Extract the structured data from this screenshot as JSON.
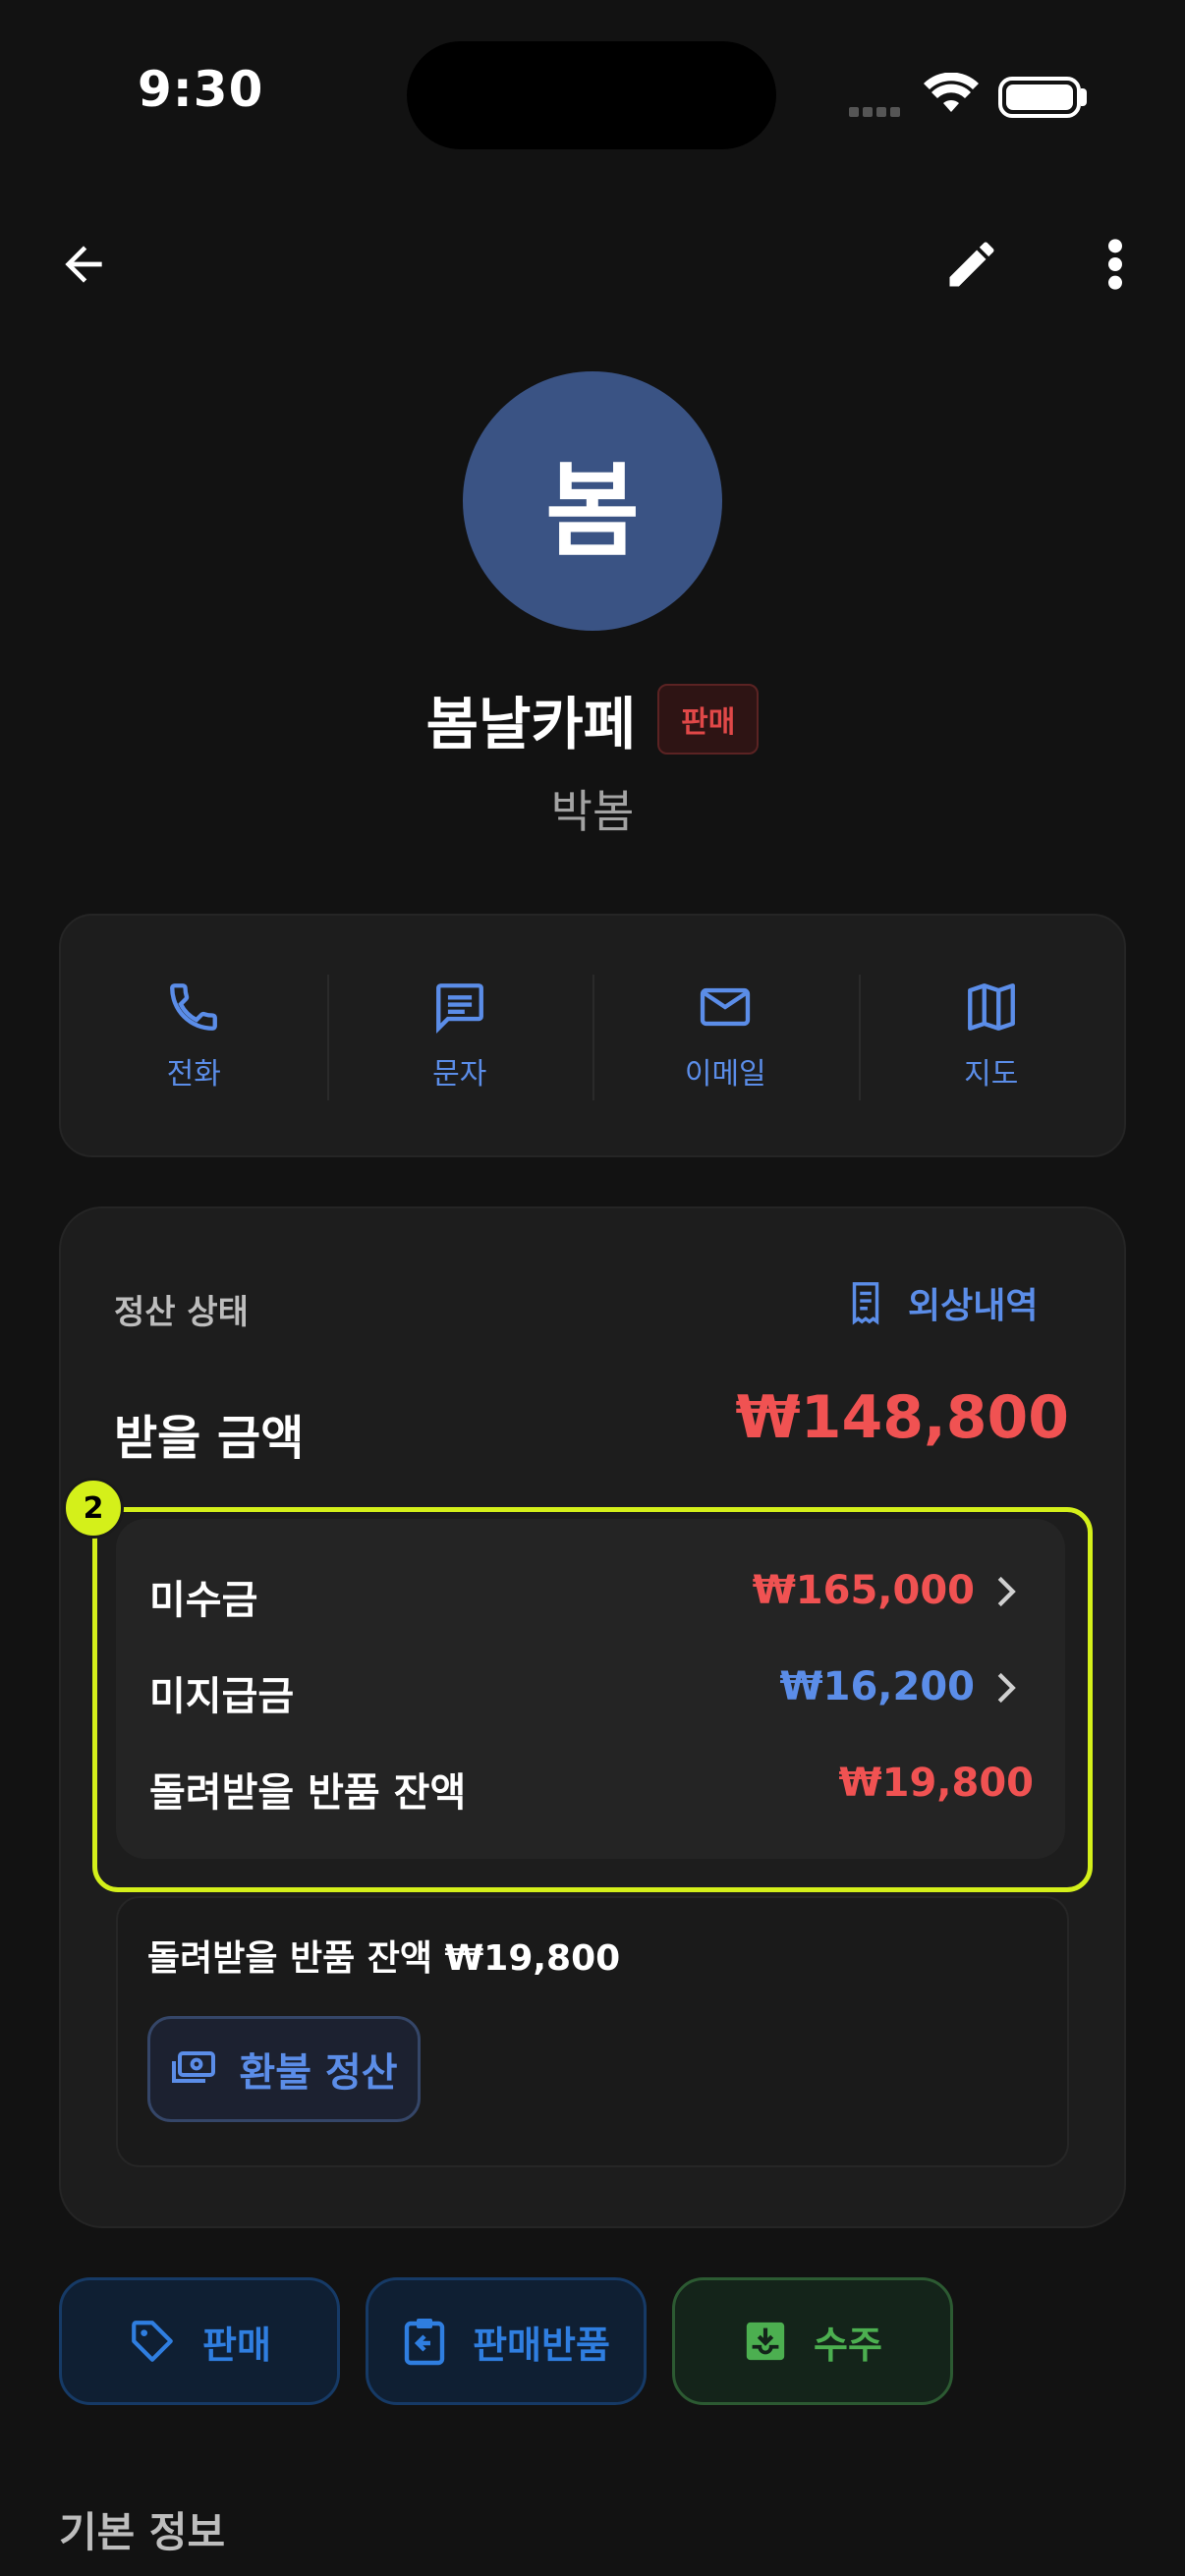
{
  "status_bar": {
    "time": "9:30"
  },
  "customer": {
    "avatar_initial": "봄",
    "name": "봄날카페",
    "type_badge": "판매",
    "contact_person": "박봄"
  },
  "contact_actions": [
    {
      "label": "전화",
      "icon": "phone-icon"
    },
    {
      "label": "문자",
      "icon": "message-icon"
    },
    {
      "label": "이메일",
      "icon": "mail-icon"
    },
    {
      "label": "지도",
      "icon": "map-icon"
    }
  ],
  "settlement": {
    "title": "정산 상태",
    "ledger_link": "외상내역",
    "receive_label": "받을 금액",
    "receive_amount": "₩148,800",
    "step_marker": "2",
    "rows": [
      {
        "label": "미수금",
        "amount": "₩165,000",
        "color": "#f05252",
        "has_chevron": true
      },
      {
        "label": "미지급금",
        "amount": "₩16,200",
        "color": "#5b8de8",
        "has_chevron": true
      },
      {
        "label": "돌려받을 반품 잔액",
        "amount": "₩19,800",
        "color": "#f05252",
        "has_chevron": false
      }
    ],
    "refund_notice": "돌려받을 반품 잔액 ₩19,800",
    "refund_button": "환불 정산"
  },
  "actions": [
    {
      "label": "판매",
      "icon": "tag-icon",
      "color": "#2f7ee0"
    },
    {
      "label": "판매반품",
      "icon": "clipboard-return-icon",
      "color": "#2f7ee0"
    },
    {
      "label": "수주",
      "icon": "inbox-download-icon",
      "color": "#4caf50"
    }
  ],
  "section": {
    "basic_info_title": "기본 정보"
  },
  "colors": {
    "accent_blue": "#5b8de8",
    "negative_red": "#f05252",
    "highlight": "#d4f01a",
    "avatar_bg": "#3a5384"
  }
}
